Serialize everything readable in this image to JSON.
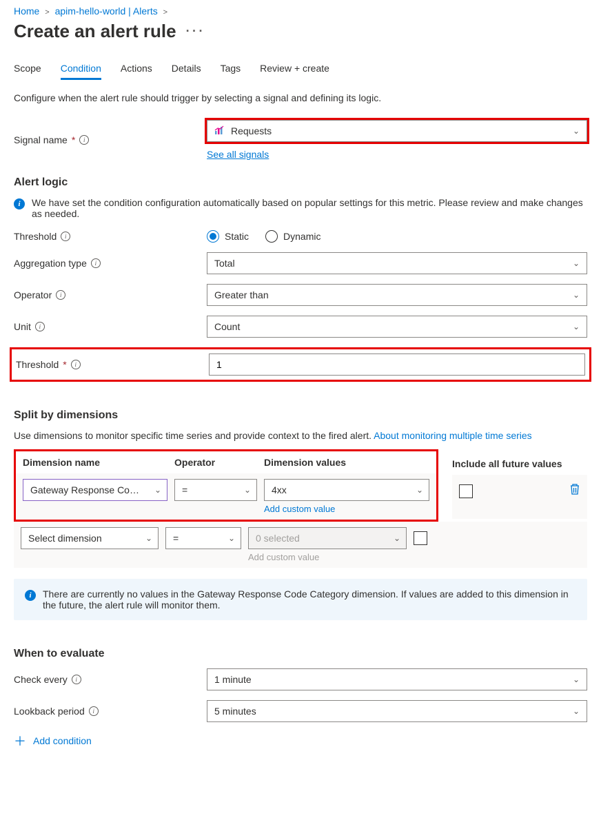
{
  "breadcrumbs": {
    "home": "Home",
    "resource": "apim-hello-world | Alerts"
  },
  "page_title": "Create an alert rule",
  "tabs": {
    "scope": "Scope",
    "condition": "Condition",
    "actions": "Actions",
    "details": "Details",
    "tags": "Tags",
    "review": "Review + create"
  },
  "intro_text": "Configure when the alert rule should trigger by selecting a signal and defining its logic.",
  "signal": {
    "label": "Signal name",
    "value": "Requests",
    "see_all": "See all signals"
  },
  "alert_logic": {
    "heading": "Alert logic",
    "info": "We have set the condition configuration automatically based on popular settings for this metric. Please review and make changes as needed.",
    "threshold_label": "Threshold",
    "static": "Static",
    "dynamic": "Dynamic",
    "agg_label": "Aggregation type",
    "agg_value": "Total",
    "op_label": "Operator",
    "op_value": "Greater than",
    "unit_label": "Unit",
    "unit_value": "Count",
    "thresh_val_label": "Threshold",
    "thresh_val": "1"
  },
  "dimensions": {
    "heading": "Split by dimensions",
    "desc_prefix": "Use dimensions to monitor specific time series and provide context to the fired alert. ",
    "desc_link": "About monitoring multiple time series",
    "col_name": "Dimension name",
    "col_op": "Operator",
    "col_vals": "Dimension values",
    "col_future": "Include all future values",
    "row1_name": "Gateway Response Co…",
    "row1_op": "=",
    "row1_vals": "4xx",
    "add_custom": "Add custom value",
    "row2_name": "Select dimension",
    "row2_op": "=",
    "row2_vals": "0 selected",
    "info_msg": "There are currently no values in the Gateway Response Code Category dimension. If values are added to this dimension in the future, the alert rule will monitor them."
  },
  "evaluate": {
    "heading": "When to evaluate",
    "check_label": "Check every",
    "check_value": "1 minute",
    "lookback_label": "Lookback period",
    "lookback_value": "5 minutes"
  },
  "add_condition": "Add condition"
}
